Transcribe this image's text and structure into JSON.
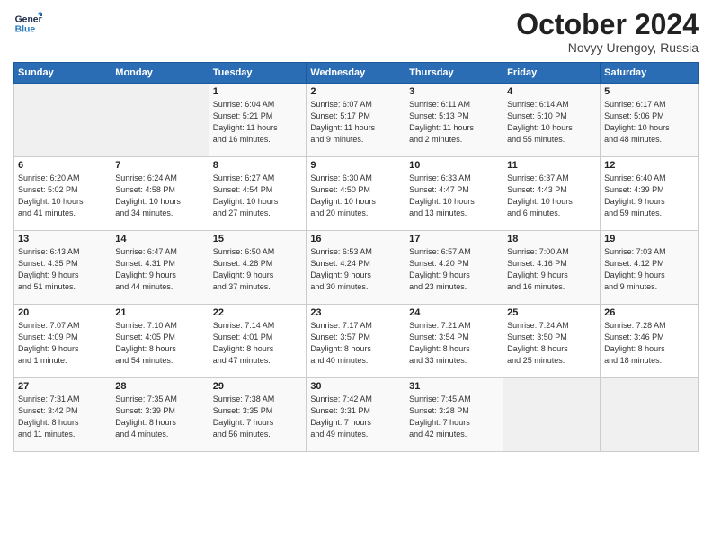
{
  "header": {
    "logo_line1": "General",
    "logo_line2": "Blue",
    "month_title": "October 2024",
    "location": "Novyy Urengoy, Russia"
  },
  "days_of_week": [
    "Sunday",
    "Monday",
    "Tuesday",
    "Wednesday",
    "Thursday",
    "Friday",
    "Saturday"
  ],
  "weeks": [
    [
      {
        "day": "",
        "info": ""
      },
      {
        "day": "",
        "info": ""
      },
      {
        "day": "1",
        "info": "Sunrise: 6:04 AM\nSunset: 5:21 PM\nDaylight: 11 hours\nand 16 minutes."
      },
      {
        "day": "2",
        "info": "Sunrise: 6:07 AM\nSunset: 5:17 PM\nDaylight: 11 hours\nand 9 minutes."
      },
      {
        "day": "3",
        "info": "Sunrise: 6:11 AM\nSunset: 5:13 PM\nDaylight: 11 hours\nand 2 minutes."
      },
      {
        "day": "4",
        "info": "Sunrise: 6:14 AM\nSunset: 5:10 PM\nDaylight: 10 hours\nand 55 minutes."
      },
      {
        "day": "5",
        "info": "Sunrise: 6:17 AM\nSunset: 5:06 PM\nDaylight: 10 hours\nand 48 minutes."
      }
    ],
    [
      {
        "day": "6",
        "info": "Sunrise: 6:20 AM\nSunset: 5:02 PM\nDaylight: 10 hours\nand 41 minutes."
      },
      {
        "day": "7",
        "info": "Sunrise: 6:24 AM\nSunset: 4:58 PM\nDaylight: 10 hours\nand 34 minutes."
      },
      {
        "day": "8",
        "info": "Sunrise: 6:27 AM\nSunset: 4:54 PM\nDaylight: 10 hours\nand 27 minutes."
      },
      {
        "day": "9",
        "info": "Sunrise: 6:30 AM\nSunset: 4:50 PM\nDaylight: 10 hours\nand 20 minutes."
      },
      {
        "day": "10",
        "info": "Sunrise: 6:33 AM\nSunset: 4:47 PM\nDaylight: 10 hours\nand 13 minutes."
      },
      {
        "day": "11",
        "info": "Sunrise: 6:37 AM\nSunset: 4:43 PM\nDaylight: 10 hours\nand 6 minutes."
      },
      {
        "day": "12",
        "info": "Sunrise: 6:40 AM\nSunset: 4:39 PM\nDaylight: 9 hours\nand 59 minutes."
      }
    ],
    [
      {
        "day": "13",
        "info": "Sunrise: 6:43 AM\nSunset: 4:35 PM\nDaylight: 9 hours\nand 51 minutes."
      },
      {
        "day": "14",
        "info": "Sunrise: 6:47 AM\nSunset: 4:31 PM\nDaylight: 9 hours\nand 44 minutes."
      },
      {
        "day": "15",
        "info": "Sunrise: 6:50 AM\nSunset: 4:28 PM\nDaylight: 9 hours\nand 37 minutes."
      },
      {
        "day": "16",
        "info": "Sunrise: 6:53 AM\nSunset: 4:24 PM\nDaylight: 9 hours\nand 30 minutes."
      },
      {
        "day": "17",
        "info": "Sunrise: 6:57 AM\nSunset: 4:20 PM\nDaylight: 9 hours\nand 23 minutes."
      },
      {
        "day": "18",
        "info": "Sunrise: 7:00 AM\nSunset: 4:16 PM\nDaylight: 9 hours\nand 16 minutes."
      },
      {
        "day": "19",
        "info": "Sunrise: 7:03 AM\nSunset: 4:12 PM\nDaylight: 9 hours\nand 9 minutes."
      }
    ],
    [
      {
        "day": "20",
        "info": "Sunrise: 7:07 AM\nSunset: 4:09 PM\nDaylight: 9 hours\nand 1 minute."
      },
      {
        "day": "21",
        "info": "Sunrise: 7:10 AM\nSunset: 4:05 PM\nDaylight: 8 hours\nand 54 minutes."
      },
      {
        "day": "22",
        "info": "Sunrise: 7:14 AM\nSunset: 4:01 PM\nDaylight: 8 hours\nand 47 minutes."
      },
      {
        "day": "23",
        "info": "Sunrise: 7:17 AM\nSunset: 3:57 PM\nDaylight: 8 hours\nand 40 minutes."
      },
      {
        "day": "24",
        "info": "Sunrise: 7:21 AM\nSunset: 3:54 PM\nDaylight: 8 hours\nand 33 minutes."
      },
      {
        "day": "25",
        "info": "Sunrise: 7:24 AM\nSunset: 3:50 PM\nDaylight: 8 hours\nand 25 minutes."
      },
      {
        "day": "26",
        "info": "Sunrise: 7:28 AM\nSunset: 3:46 PM\nDaylight: 8 hours\nand 18 minutes."
      }
    ],
    [
      {
        "day": "27",
        "info": "Sunrise: 7:31 AM\nSunset: 3:42 PM\nDaylight: 8 hours\nand 11 minutes."
      },
      {
        "day": "28",
        "info": "Sunrise: 7:35 AM\nSunset: 3:39 PM\nDaylight: 8 hours\nand 4 minutes."
      },
      {
        "day": "29",
        "info": "Sunrise: 7:38 AM\nSunset: 3:35 PM\nDaylight: 7 hours\nand 56 minutes."
      },
      {
        "day": "30",
        "info": "Sunrise: 7:42 AM\nSunset: 3:31 PM\nDaylight: 7 hours\nand 49 minutes."
      },
      {
        "day": "31",
        "info": "Sunrise: 7:45 AM\nSunset: 3:28 PM\nDaylight: 7 hours\nand 42 minutes."
      },
      {
        "day": "",
        "info": ""
      },
      {
        "day": "",
        "info": ""
      }
    ]
  ]
}
